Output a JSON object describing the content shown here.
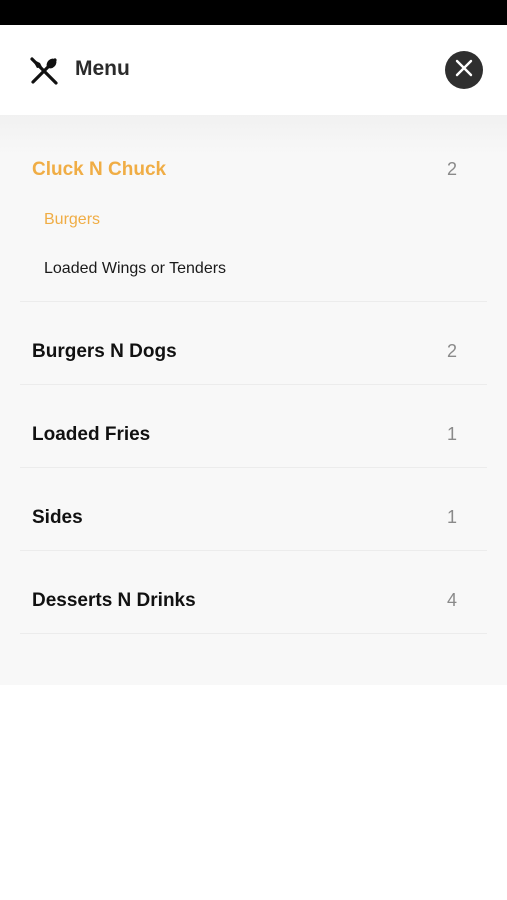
{
  "header": {
    "title": "Menu",
    "menu_icon": "fork-knife-icon",
    "close_icon": "close-icon"
  },
  "colors": {
    "accent": "#f0ad45",
    "text": "#111111",
    "count": "#8a8a8a",
    "close_bg": "#2f2f2f"
  },
  "categories": [
    {
      "label": "Cluck N Chuck",
      "count": "2",
      "expanded": true,
      "active": true,
      "items": [
        {
          "label": "Burgers",
          "active": true
        },
        {
          "label": "Loaded Wings or Tenders",
          "active": false
        }
      ]
    },
    {
      "label": "Burgers N Dogs",
      "count": "2"
    },
    {
      "label": "Loaded Fries",
      "count": "1"
    },
    {
      "label": "Sides",
      "count": "1"
    },
    {
      "label": "Desserts N Drinks",
      "count": "4"
    }
  ]
}
